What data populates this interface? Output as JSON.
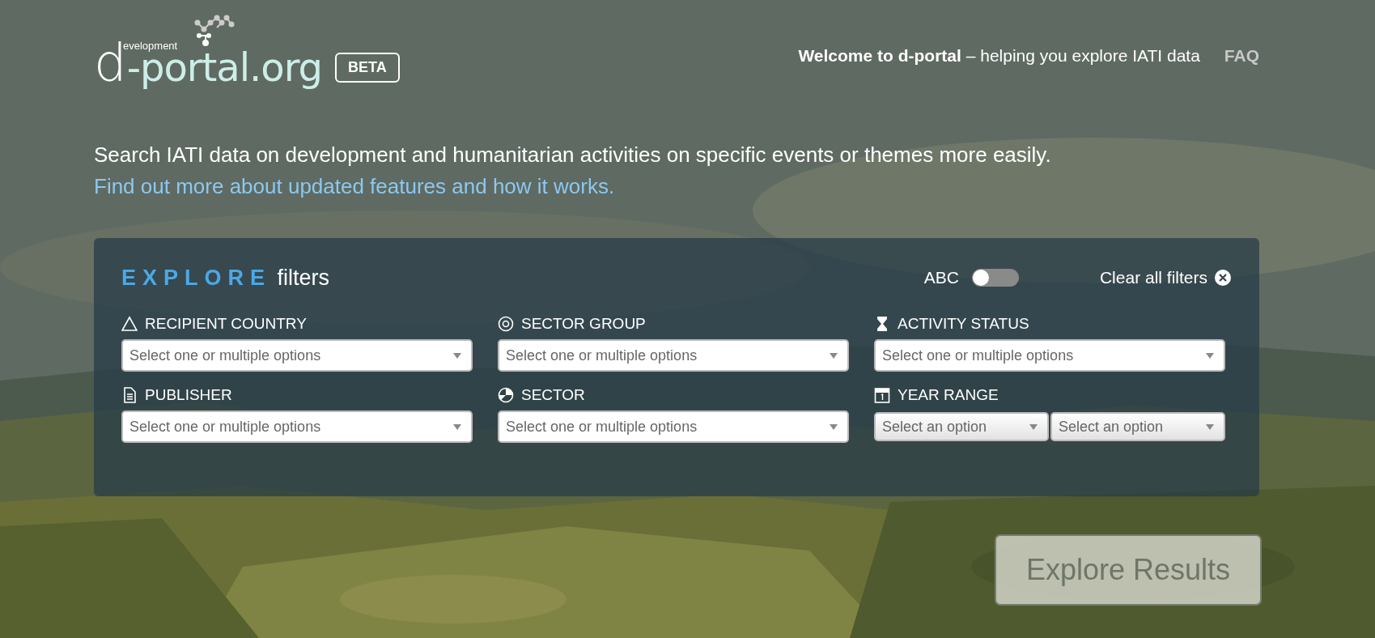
{
  "logo": {
    "initial": "d",
    "small": "evelopment",
    "rest": "-portal.org"
  },
  "badge": "BETA",
  "header": {
    "welcome_bold": "Welcome to d-portal",
    "welcome_rest": "– helping you explore IATI data",
    "faq": "FAQ"
  },
  "intro": {
    "text": "Search IATI data on development and humanitarian activities on specific events or themes more easily.",
    "link": "Find out more about updated features and how it works."
  },
  "panel": {
    "title_strong": "EXPLORE",
    "title_rest": "filters",
    "abc_toggle": {
      "label": "ABC",
      "on": false
    },
    "clear": "Clear all filters",
    "filters": [
      {
        "label": "RECIPIENT COUNTRY",
        "kind": "multi",
        "placeholders": [
          "Select one or multiple options"
        ]
      },
      {
        "label": "SECTOR GROUP",
        "kind": "multi",
        "placeholders": [
          "Select one or multiple options"
        ]
      },
      {
        "label": "ACTIVITY STATUS",
        "kind": "multi",
        "placeholders": [
          "Select one or multiple options"
        ]
      },
      {
        "label": "PUBLISHER",
        "kind": "multi",
        "placeholders": [
          "Select one or multiple options"
        ]
      },
      {
        "label": "SECTOR",
        "kind": "multi",
        "placeholders": [
          "Select one or multiple options"
        ]
      },
      {
        "label": "YEAR RANGE",
        "kind": "range",
        "placeholders": [
          "Select an option",
          "Select an option"
        ]
      }
    ]
  },
  "explore_button": {
    "label": "Explore Results",
    "disabled": true
  }
}
